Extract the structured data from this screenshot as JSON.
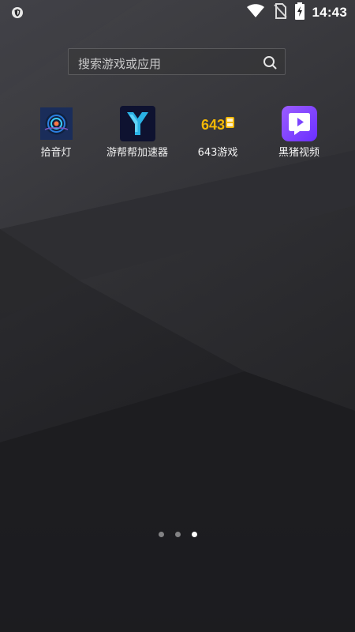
{
  "status_bar": {
    "time": "14:43",
    "left_icon": "shield-icon",
    "right_icons": [
      "wifi-icon",
      "no-sim-icon",
      "battery-charging-icon"
    ]
  },
  "search": {
    "placeholder": "搜索游戏或应用",
    "icon": "search-icon"
  },
  "apps": [
    {
      "label": "拾音灯",
      "icon": "sound-light-icon",
      "accent": "#1c3d7a"
    },
    {
      "label": "游帮帮加速器",
      "icon": "yoobang-icon",
      "accent": "#2aa8d8"
    },
    {
      "label": "643游戏",
      "icon": "643-game-icon",
      "accent": "#f2b705"
    },
    {
      "label": "黑猪视频",
      "icon": "black-pig-video-icon",
      "accent": "#7b4dff"
    }
  ],
  "page_indicator": {
    "count": 3,
    "active_index": 2
  }
}
